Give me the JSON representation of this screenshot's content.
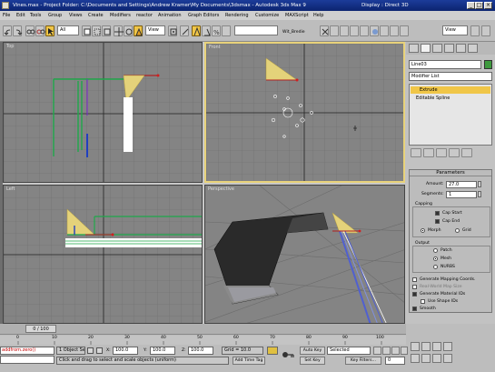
{
  "window": {
    "title": "Vines.max - Project Folder: C:\\Documents and Settings\\Andrew Kramer\\My Documents\\3dsmax - Autodesk 3ds Max 9",
    "display": "Display : Direct 3D",
    "buttons": [
      "_",
      "□",
      "×"
    ]
  },
  "menubar": [
    "File",
    "Edit",
    "Tools",
    "Group",
    "Views",
    "Create",
    "Modifiers",
    "reactor",
    "Animation",
    "Graph Editors",
    "Rendering",
    "Customize",
    "MAXScript",
    "Help"
  ],
  "toolbar": {
    "selection_filter": "All",
    "reference_coord": "View",
    "named_selection": "",
    "extra_label": "Wit_Bredie",
    "render_type": "View"
  },
  "viewports": [
    {
      "name": "Top"
    },
    {
      "name": "Front"
    },
    {
      "name": "Left"
    },
    {
      "name": "Perspective"
    }
  ],
  "command_panel": {
    "object_name": "Line03",
    "modifier_list": "Modifier List",
    "stack": [
      {
        "name": "Extrude"
      },
      {
        "name": "Editable Spline"
      }
    ],
    "parameters_title": "Parameters",
    "amount_label": "Amount:",
    "amount_value": "27.0",
    "segments_label": "Segments:",
    "segments_value": "1",
    "capping_title": "Capping",
    "cap_start": "Cap Start",
    "cap_end": "Cap End",
    "capping_radios": [
      "Morph",
      "Grid"
    ],
    "output_title": "Output",
    "output_radios": [
      "Patch",
      "Mesh",
      "NURBS"
    ],
    "gen_mapping": "Generate Mapping Coords.",
    "real_world": "Real-World Map Size",
    "gen_mat_ids": "Generate Material IDs",
    "use_shape_ids": "Use Shape IDs",
    "smooth": "Smooth"
  },
  "timeline": {
    "frame_counter": "0 / 100",
    "ruler": [
      "0",
      "10",
      "20",
      "30",
      "40",
      "50",
      "60",
      "70",
      "80",
      "90",
      "100"
    ]
  },
  "status": {
    "maxscript": "addfrom.zero()",
    "selected": "1 Object Se",
    "prompt": "Click and drag to select and scale objects (uniform)",
    "x_label": "X:",
    "x": "100.0",
    "y_label": "Y:",
    "y": "100.0",
    "z_label": "Z:",
    "z": "100.0",
    "grid": "Grid = 10.0",
    "add_time_tag": "Add Time Tag",
    "auto_key": "Auto Key",
    "selected_dropdown": "Selected",
    "set_key": "Set Key",
    "key_filters": "Key Filters...",
    "frame": "0"
  }
}
